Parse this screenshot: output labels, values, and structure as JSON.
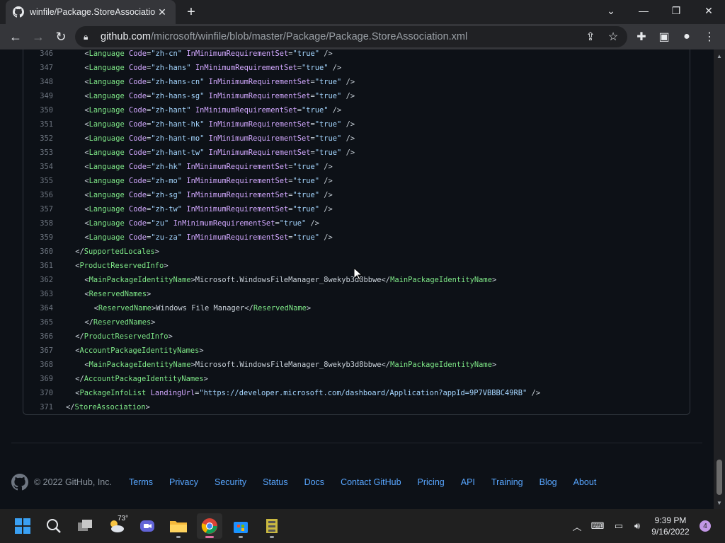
{
  "browser": {
    "tab_title": "winfile/Package.StoreAssociation",
    "url_host": "github.com",
    "url_path": "/microsoft/winfile/blob/master/Package/Package.StoreAssociation.xml"
  },
  "code": {
    "lines": [
      {
        "n": "346",
        "indent": 4,
        "parts": [
          [
            "pl",
            "<"
          ],
          [
            "tg",
            "Language"
          ],
          [
            "pl",
            " "
          ],
          [
            "at",
            "Code"
          ],
          [
            "pl",
            "="
          ],
          [
            "sv",
            "\"zh-cn\""
          ],
          [
            "pl",
            " "
          ],
          [
            "at",
            "InMinimumRequirementSet"
          ],
          [
            "pl",
            "="
          ],
          [
            "sv",
            "\"true\""
          ],
          [
            "pl",
            " />"
          ]
        ]
      },
      {
        "n": "347",
        "indent": 4,
        "parts": [
          [
            "pl",
            "<"
          ],
          [
            "tg",
            "Language"
          ],
          [
            "pl",
            " "
          ],
          [
            "at",
            "Code"
          ],
          [
            "pl",
            "="
          ],
          [
            "sv",
            "\"zh-hans\""
          ],
          [
            "pl",
            " "
          ],
          [
            "at",
            "InMinimumRequirementSet"
          ],
          [
            "pl",
            "="
          ],
          [
            "sv",
            "\"true\""
          ],
          [
            "pl",
            " />"
          ]
        ]
      },
      {
        "n": "348",
        "indent": 4,
        "parts": [
          [
            "pl",
            "<"
          ],
          [
            "tg",
            "Language"
          ],
          [
            "pl",
            " "
          ],
          [
            "at",
            "Code"
          ],
          [
            "pl",
            "="
          ],
          [
            "sv",
            "\"zh-hans-cn\""
          ],
          [
            "pl",
            " "
          ],
          [
            "at",
            "InMinimumRequirementSet"
          ],
          [
            "pl",
            "="
          ],
          [
            "sv",
            "\"true\""
          ],
          [
            "pl",
            " />"
          ]
        ]
      },
      {
        "n": "349",
        "indent": 4,
        "parts": [
          [
            "pl",
            "<"
          ],
          [
            "tg",
            "Language"
          ],
          [
            "pl",
            " "
          ],
          [
            "at",
            "Code"
          ],
          [
            "pl",
            "="
          ],
          [
            "sv",
            "\"zh-hans-sg\""
          ],
          [
            "pl",
            " "
          ],
          [
            "at",
            "InMinimumRequirementSet"
          ],
          [
            "pl",
            "="
          ],
          [
            "sv",
            "\"true\""
          ],
          [
            "pl",
            " />"
          ]
        ]
      },
      {
        "n": "350",
        "indent": 4,
        "parts": [
          [
            "pl",
            "<"
          ],
          [
            "tg",
            "Language"
          ],
          [
            "pl",
            " "
          ],
          [
            "at",
            "Code"
          ],
          [
            "pl",
            "="
          ],
          [
            "sv",
            "\"zh-hant\""
          ],
          [
            "pl",
            " "
          ],
          [
            "at",
            "InMinimumRequirementSet"
          ],
          [
            "pl",
            "="
          ],
          [
            "sv",
            "\"true\""
          ],
          [
            "pl",
            " />"
          ]
        ]
      },
      {
        "n": "351",
        "indent": 4,
        "parts": [
          [
            "pl",
            "<"
          ],
          [
            "tg",
            "Language"
          ],
          [
            "pl",
            " "
          ],
          [
            "at",
            "Code"
          ],
          [
            "pl",
            "="
          ],
          [
            "sv",
            "\"zh-hant-hk\""
          ],
          [
            "pl",
            " "
          ],
          [
            "at",
            "InMinimumRequirementSet"
          ],
          [
            "pl",
            "="
          ],
          [
            "sv",
            "\"true\""
          ],
          [
            "pl",
            " />"
          ]
        ]
      },
      {
        "n": "352",
        "indent": 4,
        "parts": [
          [
            "pl",
            "<"
          ],
          [
            "tg",
            "Language"
          ],
          [
            "pl",
            " "
          ],
          [
            "at",
            "Code"
          ],
          [
            "pl",
            "="
          ],
          [
            "sv",
            "\"zh-hant-mo\""
          ],
          [
            "pl",
            " "
          ],
          [
            "at",
            "InMinimumRequirementSet"
          ],
          [
            "pl",
            "="
          ],
          [
            "sv",
            "\"true\""
          ],
          [
            "pl",
            " />"
          ]
        ]
      },
      {
        "n": "353",
        "indent": 4,
        "parts": [
          [
            "pl",
            "<"
          ],
          [
            "tg",
            "Language"
          ],
          [
            "pl",
            " "
          ],
          [
            "at",
            "Code"
          ],
          [
            "pl",
            "="
          ],
          [
            "sv",
            "\"zh-hant-tw\""
          ],
          [
            "pl",
            " "
          ],
          [
            "at",
            "InMinimumRequirementSet"
          ],
          [
            "pl",
            "="
          ],
          [
            "sv",
            "\"true\""
          ],
          [
            "pl",
            " />"
          ]
        ]
      },
      {
        "n": "354",
        "indent": 4,
        "parts": [
          [
            "pl",
            "<"
          ],
          [
            "tg",
            "Language"
          ],
          [
            "pl",
            " "
          ],
          [
            "at",
            "Code"
          ],
          [
            "pl",
            "="
          ],
          [
            "sv",
            "\"zh-hk\""
          ],
          [
            "pl",
            " "
          ],
          [
            "at",
            "InMinimumRequirementSet"
          ],
          [
            "pl",
            "="
          ],
          [
            "sv",
            "\"true\""
          ],
          [
            "pl",
            " />"
          ]
        ]
      },
      {
        "n": "355",
        "indent": 4,
        "parts": [
          [
            "pl",
            "<"
          ],
          [
            "tg",
            "Language"
          ],
          [
            "pl",
            " "
          ],
          [
            "at",
            "Code"
          ],
          [
            "pl",
            "="
          ],
          [
            "sv",
            "\"zh-mo\""
          ],
          [
            "pl",
            " "
          ],
          [
            "at",
            "InMinimumRequirementSet"
          ],
          [
            "pl",
            "="
          ],
          [
            "sv",
            "\"true\""
          ],
          [
            "pl",
            " />"
          ]
        ]
      },
      {
        "n": "356",
        "indent": 4,
        "parts": [
          [
            "pl",
            "<"
          ],
          [
            "tg",
            "Language"
          ],
          [
            "pl",
            " "
          ],
          [
            "at",
            "Code"
          ],
          [
            "pl",
            "="
          ],
          [
            "sv",
            "\"zh-sg\""
          ],
          [
            "pl",
            " "
          ],
          [
            "at",
            "InMinimumRequirementSet"
          ],
          [
            "pl",
            "="
          ],
          [
            "sv",
            "\"true\""
          ],
          [
            "pl",
            " />"
          ]
        ]
      },
      {
        "n": "357",
        "indent": 4,
        "parts": [
          [
            "pl",
            "<"
          ],
          [
            "tg",
            "Language"
          ],
          [
            "pl",
            " "
          ],
          [
            "at",
            "Code"
          ],
          [
            "pl",
            "="
          ],
          [
            "sv",
            "\"zh-tw\""
          ],
          [
            "pl",
            " "
          ],
          [
            "at",
            "InMinimumRequirementSet"
          ],
          [
            "pl",
            "="
          ],
          [
            "sv",
            "\"true\""
          ],
          [
            "pl",
            " />"
          ]
        ]
      },
      {
        "n": "358",
        "indent": 4,
        "parts": [
          [
            "pl",
            "<"
          ],
          [
            "tg",
            "Language"
          ],
          [
            "pl",
            " "
          ],
          [
            "at",
            "Code"
          ],
          [
            "pl",
            "="
          ],
          [
            "sv",
            "\"zu\""
          ],
          [
            "pl",
            " "
          ],
          [
            "at",
            "InMinimumRequirementSet"
          ],
          [
            "pl",
            "="
          ],
          [
            "sv",
            "\"true\""
          ],
          [
            "pl",
            " />"
          ]
        ]
      },
      {
        "n": "359",
        "indent": 4,
        "parts": [
          [
            "pl",
            "<"
          ],
          [
            "tg",
            "Language"
          ],
          [
            "pl",
            " "
          ],
          [
            "at",
            "Code"
          ],
          [
            "pl",
            "="
          ],
          [
            "sv",
            "\"zu-za\""
          ],
          [
            "pl",
            " "
          ],
          [
            "at",
            "InMinimumRequirementSet"
          ],
          [
            "pl",
            "="
          ],
          [
            "sv",
            "\"true\""
          ],
          [
            "pl",
            " />"
          ]
        ]
      },
      {
        "n": "360",
        "indent": 2,
        "parts": [
          [
            "pl",
            "</"
          ],
          [
            "tg",
            "SupportedLocales"
          ],
          [
            "pl",
            ">"
          ]
        ]
      },
      {
        "n": "361",
        "indent": 2,
        "parts": [
          [
            "pl",
            "<"
          ],
          [
            "tg",
            "ProductReservedInfo"
          ],
          [
            "pl",
            ">"
          ]
        ]
      },
      {
        "n": "362",
        "indent": 4,
        "parts": [
          [
            "pl",
            "<"
          ],
          [
            "tg",
            "MainPackageIdentityName"
          ],
          [
            "pl",
            ">Microsoft.WindowsFileManager_8wekyb3d8bbwe</"
          ],
          [
            "tg",
            "MainPackageIdentityName"
          ],
          [
            "pl",
            ">"
          ]
        ]
      },
      {
        "n": "363",
        "indent": 4,
        "parts": [
          [
            "pl",
            "<"
          ],
          [
            "tg",
            "ReservedNames"
          ],
          [
            "pl",
            ">"
          ]
        ]
      },
      {
        "n": "364",
        "indent": 6,
        "parts": [
          [
            "pl",
            "<"
          ],
          [
            "tg",
            "ReservedName"
          ],
          [
            "pl",
            ">Windows File Manager</"
          ],
          [
            "tg",
            "ReservedName"
          ],
          [
            "pl",
            ">"
          ]
        ]
      },
      {
        "n": "365",
        "indent": 4,
        "parts": [
          [
            "pl",
            "</"
          ],
          [
            "tg",
            "ReservedNames"
          ],
          [
            "pl",
            ">"
          ]
        ]
      },
      {
        "n": "366",
        "indent": 2,
        "parts": [
          [
            "pl",
            "</"
          ],
          [
            "tg",
            "ProductReservedInfo"
          ],
          [
            "pl",
            ">"
          ]
        ]
      },
      {
        "n": "367",
        "indent": 2,
        "parts": [
          [
            "pl",
            "<"
          ],
          [
            "tg",
            "AccountPackageIdentityNames"
          ],
          [
            "pl",
            ">"
          ]
        ]
      },
      {
        "n": "368",
        "indent": 4,
        "parts": [
          [
            "pl",
            "<"
          ],
          [
            "tg",
            "MainPackageIdentityName"
          ],
          [
            "pl",
            ">Microsoft.WindowsFileManager_8wekyb3d8bbwe</"
          ],
          [
            "tg",
            "MainPackageIdentityName"
          ],
          [
            "pl",
            ">"
          ]
        ]
      },
      {
        "n": "369",
        "indent": 2,
        "parts": [
          [
            "pl",
            "</"
          ],
          [
            "tg",
            "AccountPackageIdentityNames"
          ],
          [
            "pl",
            ">"
          ]
        ]
      },
      {
        "n": "370",
        "indent": 2,
        "parts": [
          [
            "pl",
            "<"
          ],
          [
            "tg",
            "PackageInfoList"
          ],
          [
            "pl",
            " "
          ],
          [
            "at",
            "LandingUrl"
          ],
          [
            "pl",
            "="
          ],
          [
            "sv",
            "\"https://developer.microsoft.com/dashboard/Application?appId=9P7VBBBC49RB\""
          ],
          [
            "pl",
            " />"
          ]
        ]
      },
      {
        "n": "371",
        "indent": 0,
        "parts": [
          [
            "pl",
            "</"
          ],
          [
            "tg",
            "StoreAssociation"
          ],
          [
            "pl",
            ">"
          ]
        ]
      }
    ]
  },
  "footer": {
    "copyright": "© 2022 GitHub, Inc.",
    "links": [
      "Terms",
      "Privacy",
      "Security",
      "Status",
      "Docs",
      "Contact GitHub",
      "Pricing",
      "API",
      "Training",
      "Blog",
      "About"
    ]
  },
  "taskbar": {
    "weather_temp": "73°",
    "time": "9:39 PM",
    "date": "9/16/2022",
    "notification_count": "4"
  }
}
